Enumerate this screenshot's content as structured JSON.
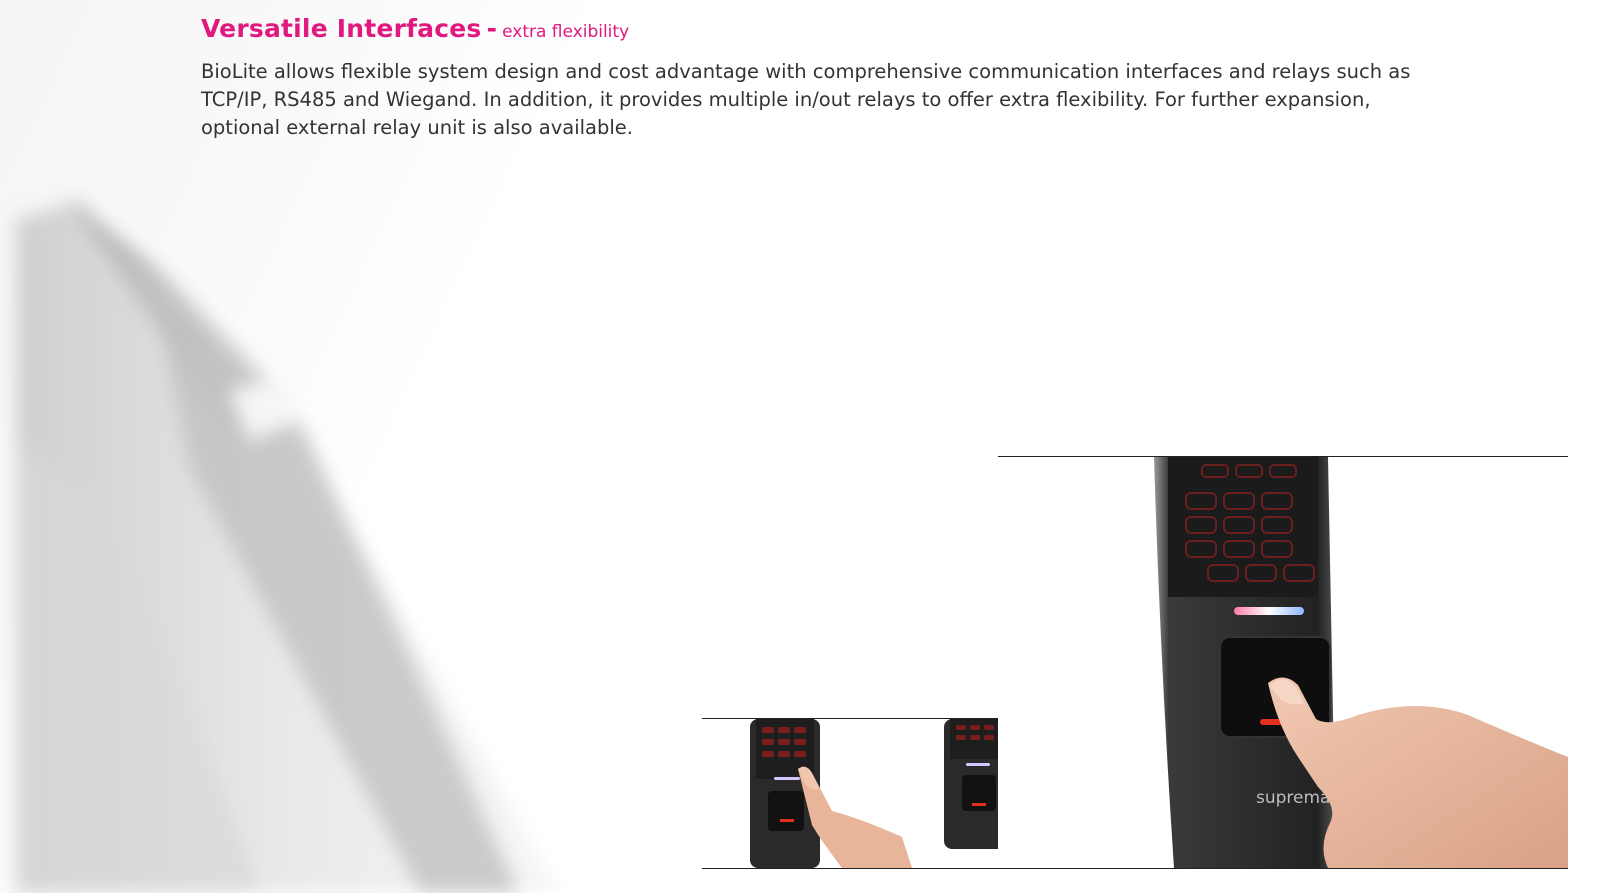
{
  "section": {
    "title": "Versatile Interfaces",
    "separator": "-",
    "subtitle": "extra flexibility",
    "body": "BioLite allows flexible system design and cost advantage with comprehensive communication interfaces and relays such as TCP/IP, RS485 and Wiegand. In addition, it provides multiple in/out relays to offer extra flexibility. For further expansion, optional external relay unit is also available."
  },
  "brand": {
    "logo_text": "suprema",
    "accent_color": "#e0187f"
  },
  "photos": [
    {
      "subject": "device-with-finger-on-keypad-small"
    },
    {
      "subject": "device-with-card-small"
    },
    {
      "subject": "device-with-finger-on-sensor-large"
    }
  ]
}
